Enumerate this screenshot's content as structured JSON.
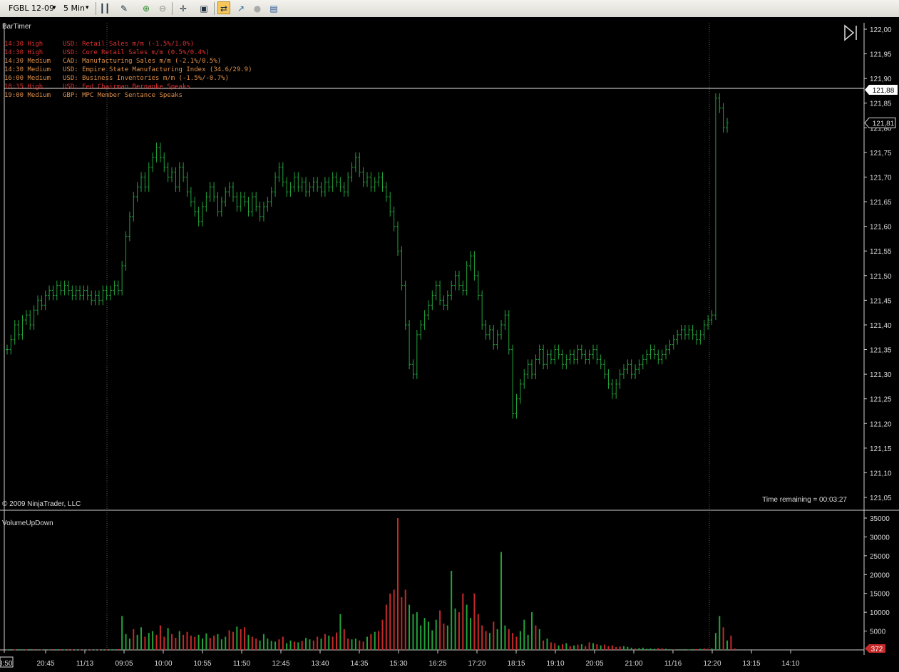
{
  "toolbar": {
    "instrument": "FGBL 12-09",
    "interval": "5 Min",
    "icons": [
      "bar-type-icon",
      "draw-tool-icon",
      "zoom-in-icon",
      "zoom-out-icon",
      "crosshair-icon",
      "properties-icon",
      "chart-trader-icon",
      "strategy-icon",
      "misc-icon",
      "data-box-icon"
    ]
  },
  "colors": {
    "background": "#000000",
    "up": "#22a33a",
    "down": "#c62a2a",
    "text": "#dcdcdc",
    "news_high": "#e03030",
    "news_medium": "#e0904a",
    "price_marker_bg": "#ffffff",
    "volume_marker_bg": "#c62a2a"
  },
  "price_panel": {
    "indicator_label": "BarTimer",
    "copyright": "© 2009 NinjaTrader, LLC",
    "time_remaining": "Time remaining = 00:03:27",
    "y_ticks": [
      "122,00",
      "121,95",
      "121,90",
      "121,85",
      "121,80",
      "121,75",
      "121,70",
      "121,65",
      "121,60",
      "121,55",
      "121,50",
      "121,45",
      "121,40",
      "121,35",
      "121,30",
      "121,25",
      "121,20",
      "121,15",
      "121,10",
      "121,05"
    ],
    "last_price_label": "121,88",
    "current_price_label": "121,81",
    "news": [
      {
        "time": "14:30",
        "importance": "High",
        "text": "USD: Retail Sales m/m (-1.5%/1.0%)"
      },
      {
        "time": "14:30",
        "importance": "High",
        "text": "USD: Core Retail Sales m/m (0.5%/0.4%)"
      },
      {
        "time": "14:30",
        "importance": "Medium",
        "text": "CAD: Manufacturing Sales m/m (-2.1%/0.5%)"
      },
      {
        "time": "14:30",
        "importance": "Medium",
        "text": "USD: Empire State Manufacturing Index (34.6/29.9)"
      },
      {
        "time": "16:00",
        "importance": "Medium",
        "text": "USD: Business Inventories m/m (-1.5%/-0.7%)"
      },
      {
        "time": "18:15",
        "importance": "High",
        "text": "USD: Fed Chairman Bernanke Speaks"
      },
      {
        "time": "19:00",
        "importance": "Medium",
        "text": "GBP: MPC Member Sentance Speaks"
      }
    ]
  },
  "volume_panel": {
    "indicator_label": "VolumeUpDown",
    "y_ticks": [
      "35000",
      "30000",
      "25000",
      "20000",
      "15000",
      "10000",
      "5000"
    ],
    "current_volume_label": "372"
  },
  "x_ticks": [
    "20:45",
    "11/13",
    "09:05",
    "10:00",
    "10:55",
    "11:50",
    "12:45",
    "13:40",
    "14:35",
    "15:30",
    "16:25",
    "17:20",
    "18:15",
    "19:10",
    "20:05",
    "21:00",
    "11/16",
    "12:20",
    "13:15",
    "14:10"
  ],
  "x_left_clipped": "8:50",
  "chart_data": {
    "type": "line",
    "title": "FGBL 12-09 5 Min",
    "ylim": [
      121.05,
      122.0
    ],
    "session_breaks": [
      "11/13",
      "11/16"
    ],
    "price_close": [
      121.35,
      121.37,
      121.4,
      121.38,
      121.41,
      121.42,
      121.4,
      121.43,
      121.45,
      121.44,
      121.46,
      121.47,
      121.46,
      121.48,
      121.47,
      121.48,
      121.47,
      121.46,
      121.47,
      121.46,
      121.47,
      121.46,
      121.45,
      121.46,
      121.45,
      121.47,
      121.46,
      121.47,
      121.48,
      121.47,
      121.52,
      121.58,
      121.62,
      121.66,
      121.68,
      121.7,
      121.68,
      121.72,
      121.74,
      121.76,
      121.74,
      121.72,
      121.7,
      121.71,
      121.68,
      121.72,
      121.7,
      121.67,
      121.65,
      121.63,
      121.61,
      121.64,
      121.66,
      121.68,
      121.66,
      121.63,
      121.65,
      121.67,
      121.68,
      121.66,
      121.64,
      121.66,
      121.65,
      121.63,
      121.66,
      121.64,
      121.62,
      121.64,
      121.65,
      121.67,
      121.7,
      121.72,
      121.69,
      121.67,
      121.68,
      121.7,
      121.68,
      121.69,
      121.67,
      121.68,
      121.69,
      121.68,
      121.67,
      121.69,
      121.68,
      121.7,
      121.69,
      121.68,
      121.67,
      121.7,
      121.72,
      121.74,
      121.71,
      121.69,
      121.7,
      121.68,
      121.69,
      121.7,
      121.68,
      121.66,
      121.63,
      121.6,
      121.55,
      121.48,
      121.4,
      121.32,
      121.3,
      121.38,
      121.4,
      121.42,
      121.44,
      121.46,
      121.48,
      121.45,
      121.44,
      121.46,
      121.48,
      121.5,
      121.48,
      121.47,
      121.52,
      121.54,
      121.5,
      121.46,
      121.4,
      121.38,
      121.39,
      121.36,
      121.38,
      121.4,
      121.42,
      121.35,
      121.22,
      121.25,
      121.28,
      121.3,
      121.32,
      121.3,
      121.33,
      121.35,
      121.32,
      121.34,
      121.33,
      121.35,
      121.34,
      121.32,
      121.33,
      121.34,
      121.33,
      121.35,
      121.34,
      121.33,
      121.34,
      121.35,
      121.33,
      121.32,
      121.3,
      121.28,
      121.26,
      121.28,
      121.3,
      121.31,
      121.32,
      121.3,
      121.31,
      121.32,
      121.33,
      121.34,
      121.35,
      121.34,
      121.33,
      121.34,
      121.35,
      121.36,
      121.37,
      121.38,
      121.39,
      121.38,
      121.39,
      121.38,
      121.37,
      121.38,
      121.4,
      121.41,
      121.42,
      121.86,
      121.84,
      121.8,
      121.81
    ],
    "volume": [
      150,
      200,
      120,
      180,
      160,
      140,
      220,
      180,
      150,
      120,
      160,
      140,
      200,
      180,
      160,
      120,
      140,
      100,
      90,
      80,
      120,
      100,
      80,
      100,
      90,
      80,
      100,
      120,
      150,
      200,
      9000,
      4200,
      3000,
      5500,
      4000,
      6000,
      3500,
      4500,
      5000,
      4000,
      6500,
      3500,
      5800,
      4200,
      3200,
      5000,
      4000,
      4800,
      3800,
      3500,
      4000,
      3000,
      4400,
      3200,
      3800,
      4200,
      2800,
      3500,
      5200,
      4800,
      6200,
      5500,
      6000,
      4000,
      3500,
      3000,
      2500,
      4200,
      3000,
      2400,
      2200,
      2800,
      3500,
      1800,
      2500,
      2200,
      2000,
      2400,
      3200,
      2800,
      2500,
      3500,
      3000,
      4200,
      3800,
      3500,
      4600,
      9500,
      5500,
      3000,
      2800,
      3000,
      2500,
      2200,
      3500,
      4200,
      4800,
      5000,
      8000,
      12000,
      15000,
      16000,
      35000,
      14000,
      16000,
      12000,
      9500,
      10000,
      6500,
      8500,
      7500,
      5200,
      8000,
      10500,
      7000,
      6500,
      21000,
      11000,
      10000,
      15000,
      12000,
      8500,
      15000,
      9500,
      6500,
      5000,
      4500,
      7500,
      5500,
      26000,
      6500,
      5500,
      4500,
      3500,
      5000,
      8000,
      4000,
      10000,
      6500,
      5500,
      2500,
      3000,
      2000,
      1800,
      1200,
      1500,
      1800,
      1000,
      1200,
      1400,
      1500,
      1000,
      2000,
      1800,
      1500,
      1200,
      1400,
      1000,
      1200,
      800,
      900,
      1000,
      800,
      600,
      400,
      500,
      600,
      300,
      400,
      300,
      500,
      400,
      300,
      200,
      150,
      200,
      180,
      200,
      150,
      200,
      250,
      300,
      400,
      300,
      400,
      4500,
      9000,
      6000,
      2500,
      3800,
      372
    ],
    "volume_direction_up": [
      true,
      true,
      false,
      true,
      true,
      false,
      true,
      false,
      true,
      false,
      true,
      true,
      false,
      true,
      false,
      true,
      false,
      false,
      true,
      false,
      true,
      false,
      false,
      true,
      false,
      true,
      false,
      true,
      true,
      false,
      true,
      true,
      true,
      false,
      true,
      true,
      false,
      true,
      true,
      false,
      false,
      false,
      true,
      false,
      false,
      true,
      false,
      false,
      false,
      false,
      true,
      true,
      true,
      false,
      false,
      true,
      true,
      true,
      false,
      false,
      true,
      false,
      false,
      true,
      false,
      false,
      true,
      true,
      true,
      true,
      true,
      false,
      false,
      true,
      true,
      false,
      true,
      false,
      true,
      true,
      false,
      false,
      true,
      false,
      true,
      false,
      false,
      true,
      false,
      false,
      true,
      true,
      false,
      false,
      true,
      false,
      true,
      false,
      false,
      false,
      false,
      false,
      false,
      false,
      false,
      true,
      true,
      true,
      true,
      true,
      true,
      true,
      true,
      false,
      false,
      true,
      true,
      true,
      false,
      false,
      true,
      true,
      false,
      false,
      false,
      false,
      true,
      false,
      true,
      true,
      true,
      false,
      false,
      false,
      true,
      true,
      true,
      true,
      false,
      true,
      false,
      true,
      false,
      false,
      true,
      false,
      true,
      false,
      true,
      false,
      true,
      false,
      false,
      true,
      false,
      true,
      false,
      false,
      false,
      false,
      false,
      true,
      true,
      true,
      false,
      true,
      true,
      true,
      true,
      true,
      false,
      false,
      true,
      true,
      false,
      true,
      true,
      true,
      true,
      true,
      false,
      true,
      false,
      false,
      true,
      true,
      true,
      false,
      true,
      false,
      false,
      true,
      true,
      false,
      false
    ],
    "grid": false,
    "legend": "none"
  }
}
